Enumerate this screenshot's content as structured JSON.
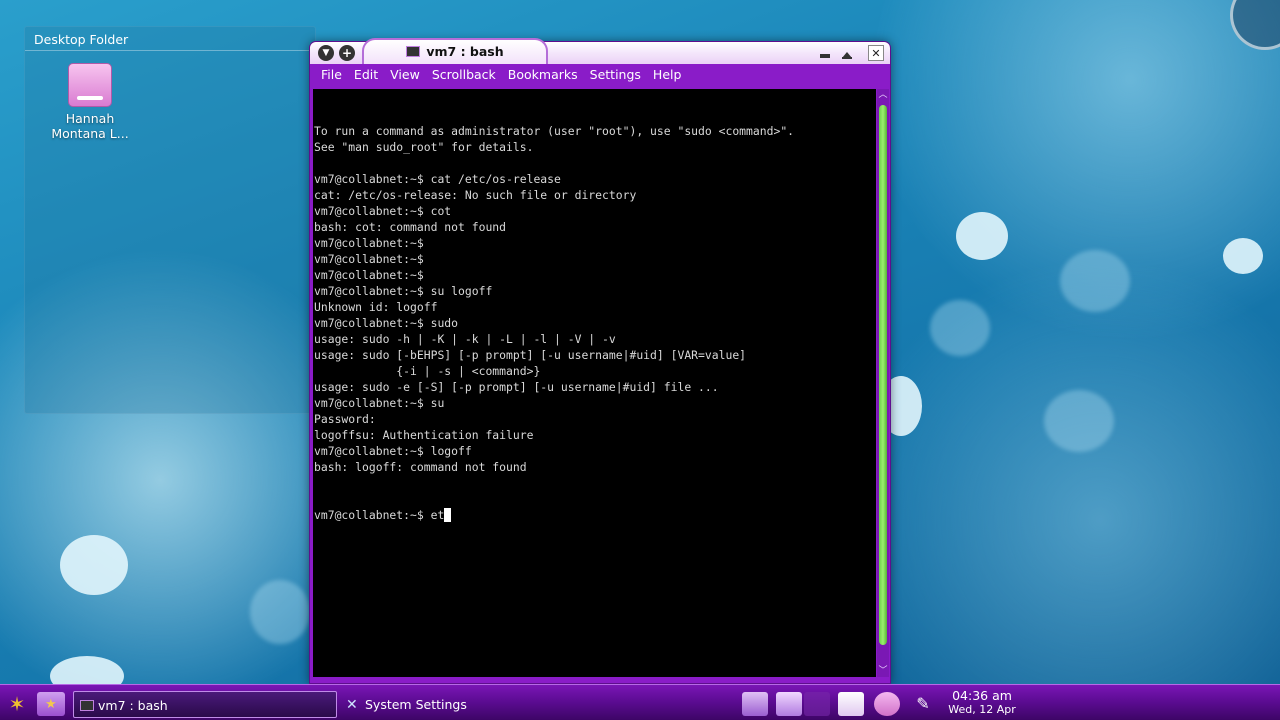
{
  "desktop": {
    "folder_title": "Desktop Folder",
    "icons": [
      {
        "label": "Hannah Montana L...",
        "icon": "disk-drive-icon"
      }
    ]
  },
  "window": {
    "title": "vm7 : bash",
    "menu": [
      "File",
      "Edit",
      "View",
      "Scrollback",
      "Bookmarks",
      "Settings",
      "Help"
    ],
    "terminal_lines": [
      "To run a command as administrator (user \"root\"), use \"sudo <command>\".",
      "See \"man sudo_root\" for details.",
      "",
      "vm7@collabnet:~$ cat /etc/os-release",
      "cat: /etc/os-release: No such file or directory",
      "vm7@collabnet:~$ cot",
      "bash: cot: command not found",
      "vm7@collabnet:~$",
      "vm7@collabnet:~$",
      "vm7@collabnet:~$",
      "vm7@collabnet:~$ su logoff",
      "Unknown id: logoff",
      "vm7@collabnet:~$ sudo",
      "usage: sudo -h | -K | -k | -L | -l | -V | -v",
      "usage: sudo [-bEHPS] [-p prompt] [-u username|#uid] [VAR=value]",
      "            {-i | -s | <command>}",
      "usage: sudo -e [-S] [-p prompt] [-u username|#uid] file ...",
      "vm7@collabnet:~$ su",
      "Password:",
      "logoffsu: Authentication failure",
      "vm7@collabnet:~$ logoff",
      "bash: logoff: command not found"
    ],
    "current_input_line": "vm7@collabnet:~$ et"
  },
  "taskbar": {
    "tasks": [
      {
        "label": "vm7 : bash",
        "active": true,
        "icon": "terminal-icon"
      },
      {
        "label": "System Settings",
        "active": false,
        "icon": "tools-icon"
      }
    ],
    "clock": {
      "time": "04:36 am",
      "date": "Wed, 12 Apr"
    }
  },
  "colors": {
    "window_frame": "#8a1cc8",
    "scroll_thumb": "#7ddc58",
    "terminal_bg": "#000000",
    "terminal_fg": "#d9d9d9"
  }
}
